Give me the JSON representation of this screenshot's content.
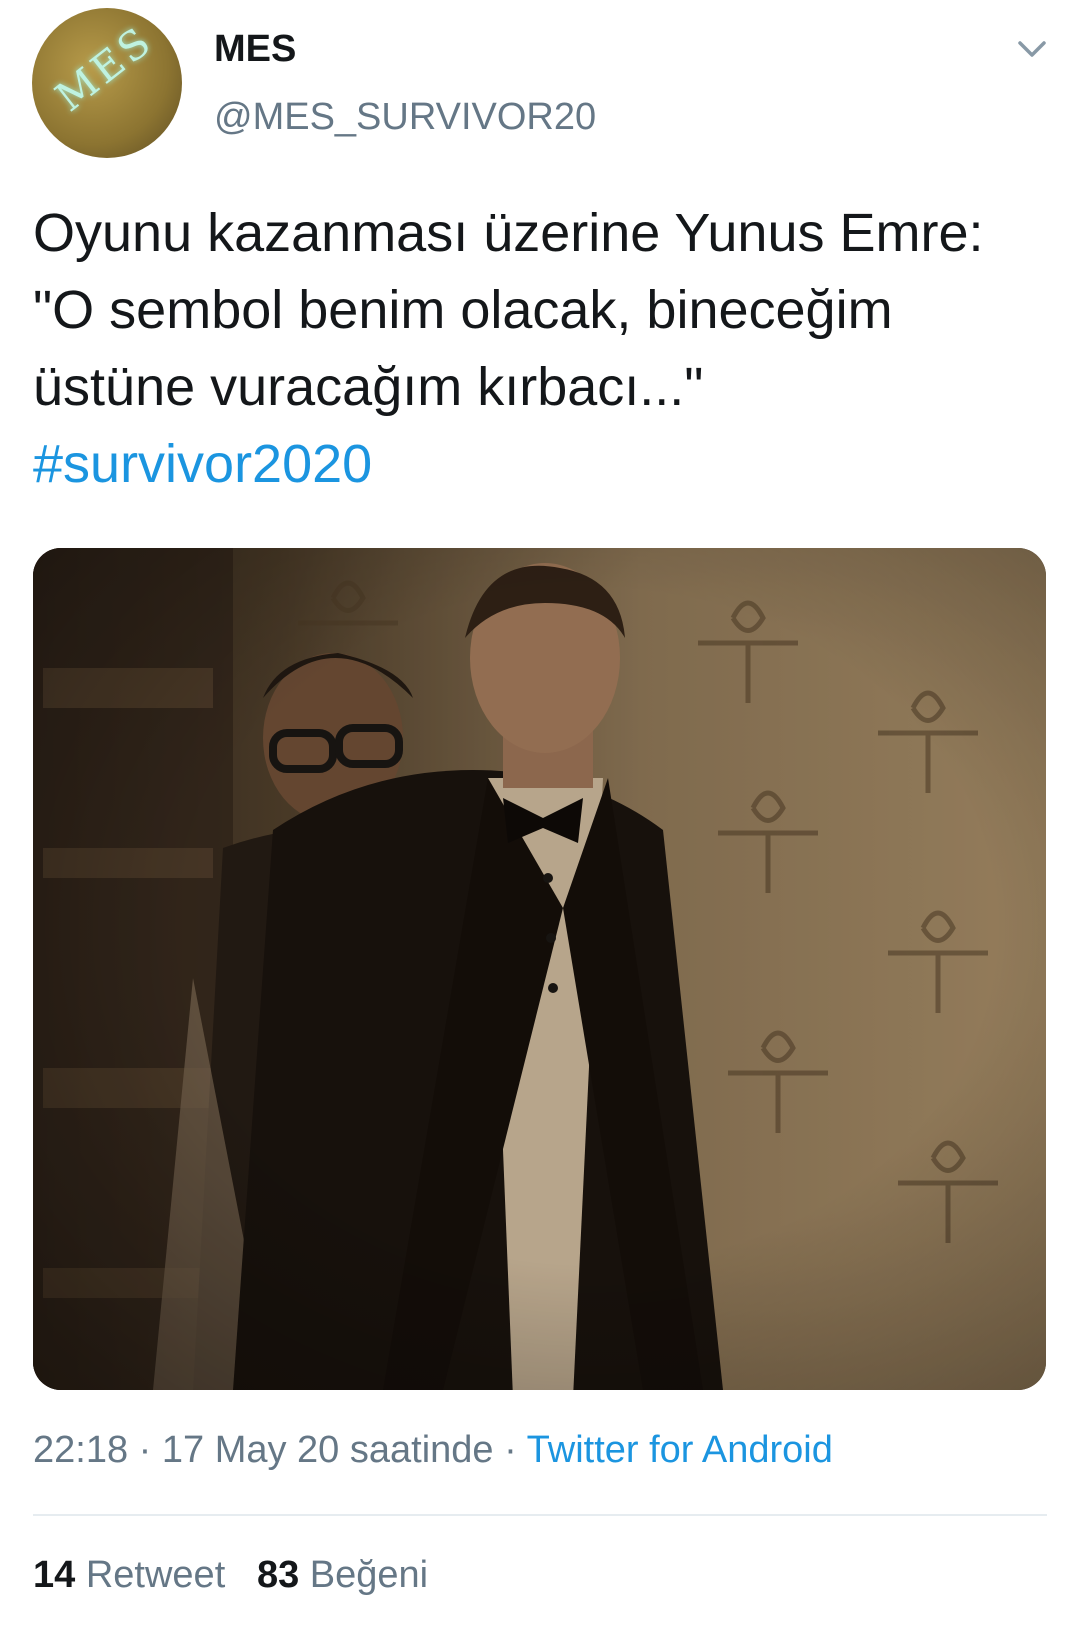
{
  "user": {
    "display_name": "MES",
    "handle": "@MES_SURVIVOR20",
    "avatar_text": "MES"
  },
  "tweet": {
    "text": "Oyunu kazanması üzerine Yunus Emre: \"O sembol benim olacak, bineceğim üstüne vuracağım kırbacı...\"",
    "hashtag": "#survivor2020"
  },
  "meta": {
    "time": "22:18",
    "date": "17 May 20 saatinde",
    "separator": "·",
    "source": "Twitter for Android"
  },
  "stats": {
    "retweets_count": "14",
    "retweets_label": "Retweet",
    "likes_count": "83",
    "likes_label": "Beğeni"
  },
  "icons": {
    "menu": "chevron-down-icon"
  },
  "colors": {
    "link": "#1b95e0",
    "secondary": "#657786",
    "text": "#14171a"
  }
}
